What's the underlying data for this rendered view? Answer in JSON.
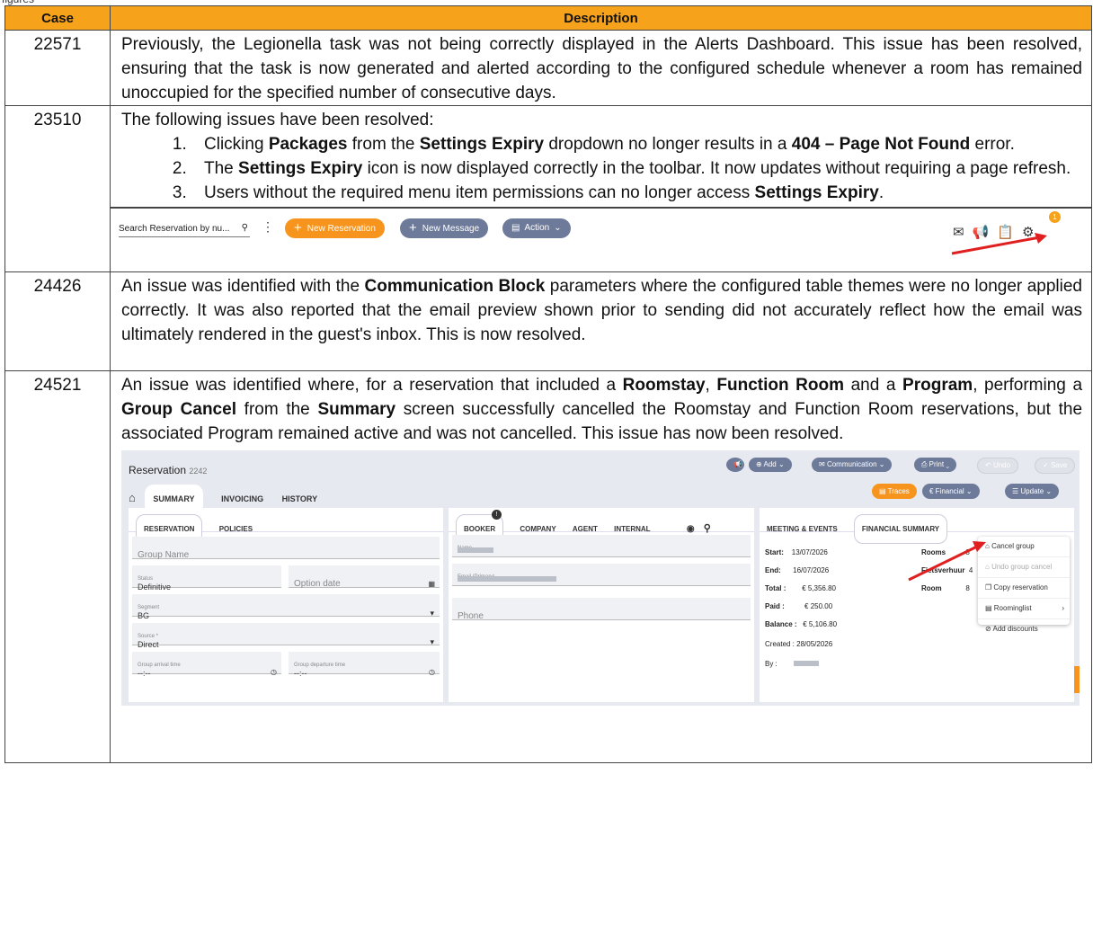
{
  "top_clip": "figures",
  "table": {
    "headers": [
      "Case",
      "Description"
    ],
    "rows": [
      {
        "case": "22571",
        "text": "Previously, the Legionella task was not being correctly displayed in the Alerts Dashboard. This issue has been resolved, ensuring that the task is now generated and alerted according to the configured schedule whenever a room has remained unoccupied for the specified number of consecutive days."
      },
      {
        "case": "23510",
        "intro": "The following issues have been resolved:",
        "items": [
          {
            "a": "Clicking ",
            "b1": "Packages",
            "c": " from the ",
            "b2": "Settings Expiry",
            "d": " dropdown no longer results in a ",
            "b3": "404 – Page Not Found",
            "e": " error."
          },
          {
            "a": "The ",
            "b1": "Settings Expiry",
            "c": " icon is now displayed correctly in the toolbar. It now updates without requiring a page refresh."
          },
          {
            "a": "Users without the required menu item permissions can no longer access ",
            "b1": "Settings Expiry",
            "c": "."
          }
        ],
        "toolbar": {
          "search_placeholder": "Search Reservation by nu...",
          "search_icon": "search-icon",
          "kebab": "⋮",
          "new_reservation": "New Reservation",
          "new_message": "New Message",
          "action": "Action",
          "badge": "1",
          "icons": [
            "mail-icon",
            "megaphone-icon",
            "checklist-icon",
            "gear-icon"
          ],
          "accent": "#f7941d",
          "slate": "#6d7a99"
        }
      },
      {
        "case": "24426",
        "a": "An issue was identified with the ",
        "b": "Communication Block",
        "c": " parameters where the configured table themes were no longer applied correctly. It was also reported that the email preview shown prior to sending did not accurately reflect how the email was ultimately rendered in the guest's inbox. This is now resolved."
      },
      {
        "case": "24521",
        "p": [
          "An issue was identified where, for a reservation that included a ",
          "Roomstay",
          ", ",
          "Function Room",
          " and a ",
          "Program",
          ", performing a ",
          "Group Cancel",
          " from the ",
          "Summary",
          " screen successfully cancelled the Roomstay and Function Room reservations, but the associated Program remained active and was not cancelled. This issue has now been resolved."
        ],
        "reservation": {
          "title": "Reservation",
          "number": "2242",
          "top_buttons": [
            "Add",
            "Communication",
            "Print",
            "Undo",
            "Save"
          ],
          "tabs": [
            "SUMMARY",
            "INVOICING",
            "HISTORY"
          ],
          "right_buttons": [
            "Traces",
            "Financial",
            "Update"
          ],
          "left_tabs": [
            "RESERVATION",
            "POLICIES"
          ],
          "group_name_ph": "Group Name",
          "status_label": "Status",
          "status_value": "Definitive",
          "option_date_ph": "Option date",
          "segment_label": "Segment",
          "segment_value": "BG",
          "source_label": "Source *",
          "source_value": "Direct",
          "arrival_label": "Group arrival time",
          "departure_label": "Group departure time",
          "time_value": "--:--",
          "mid_tabs": [
            "BOOKER",
            "COMPANY",
            "AGENT",
            "INTERNAL"
          ],
          "booker_badge": "!",
          "name_label": "Name",
          "email_label": "Email (Primary)",
          "phone_ph": "Phone",
          "right_tabs": [
            "MEETING & EVENTS",
            "FINANCIAL SUMMARY"
          ],
          "summary": [
            [
              "Start:",
              "13/07/2026"
            ],
            [
              "End:",
              "16/07/2026"
            ],
            [
              "Total :",
              "€ 5,356.80"
            ],
            [
              "Paid :",
              "€ 250.00"
            ],
            [
              "Balance :",
              "€ 5,106.80"
            ]
          ],
          "created": "Created : 28/05/2026",
          "by": "By :",
          "rooms": [
            [
              "Rooms",
              "8"
            ],
            [
              "Fietsverhuur",
              "4"
            ],
            [
              "Room",
              "8"
            ]
          ],
          "menu": [
            "Cancel group",
            "Undo group cancel",
            "Copy reservation",
            "Roominglist",
            "Add discounts"
          ]
        }
      }
    ]
  }
}
